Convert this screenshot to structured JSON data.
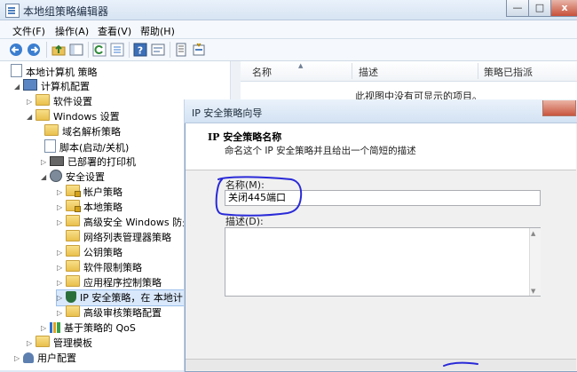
{
  "window": {
    "title": "本地组策略编辑器",
    "controls": {
      "minimize": "—",
      "maximize": "□",
      "close": "x"
    }
  },
  "menu": [
    "文件(F)",
    "操作(A)",
    "查看(V)",
    "帮助(H)"
  ],
  "toolbar": {
    "icons": [
      "back-arrow-icon",
      "forward-arrow-icon",
      "up-folder-icon",
      "show-hide-tree-icon",
      "refresh-icon",
      "export-list-icon",
      "help-icon",
      "properties-icon",
      "policy-icon",
      "wizard-icon"
    ]
  },
  "tree": {
    "items": [
      {
        "label": "本地计算机 策略"
      },
      {
        "label": "计算机配置"
      },
      {
        "label": "软件设置"
      },
      {
        "label": "Windows 设置"
      },
      {
        "label": "域名解析策略"
      },
      {
        "label": "脚本(启动/关机)"
      },
      {
        "label": "已部署的打印机"
      },
      {
        "label": "安全设置"
      },
      {
        "label": "帐户策略"
      },
      {
        "label": "本地策略"
      },
      {
        "label": "高级安全 Windows 防火"
      },
      {
        "label": "网络列表管理器策略"
      },
      {
        "label": "公钥策略"
      },
      {
        "label": "软件限制策略"
      },
      {
        "label": "应用程序控制策略"
      },
      {
        "label": "IP 安全策略，在 本地计"
      },
      {
        "label": "高级审核策略配置"
      },
      {
        "label": "基于策略的 QoS"
      },
      {
        "label": "管理模板"
      },
      {
        "label": "用户配置"
      }
    ]
  },
  "list": {
    "columns": [
      "名称",
      "描述",
      "策略已指派"
    ],
    "empty_message": "此视图中没有可显示的项目。"
  },
  "dialog": {
    "title": "IP 安全策略向导",
    "header_title": "IP 安全策略名称",
    "header_subtitle": "命名这个 IP 安全策略并且给出一个简短的描述",
    "name_label": "名称(M):",
    "name_value": "关闭445端口",
    "desc_label": "描述(D):",
    "desc_value": ""
  },
  "colors": {
    "annotation_ink": "#2a2ad8",
    "title_gradient_top": "#e9f1fb",
    "close_red": "#c8503a"
  }
}
